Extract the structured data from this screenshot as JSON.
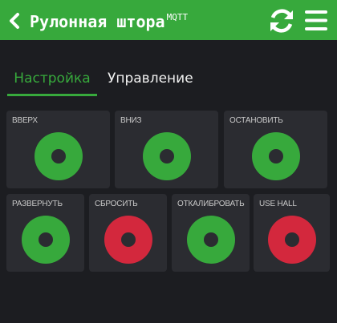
{
  "header": {
    "title": "Рулонная штора",
    "title_suffix": "MQTT",
    "background_color": "#37a93c",
    "back_icon": "chevron-left-icon",
    "refresh_icon": "refresh-icon",
    "menu_icon": "hamburger-menu-icon"
  },
  "tabs": [
    {
      "label": "Настройка",
      "active": true
    },
    {
      "label": "Управление",
      "active": false
    }
  ],
  "controls": [
    {
      "label": "ВВЕРХ",
      "state": "on",
      "color": "#37a93c"
    },
    {
      "label": "ВНИЗ",
      "state": "on",
      "color": "#37a93c"
    },
    {
      "label": "ОСТАНОВИТЬ",
      "state": "on",
      "color": "#37a93c"
    },
    {
      "label": "РАЗВЕРНУТЬ",
      "state": "on",
      "color": "#37a93c"
    },
    {
      "label": "СБРОСИТЬ",
      "state": "off",
      "color": "#d3283d"
    },
    {
      "label": "ОТКАЛИБРОВАТЬ",
      "state": "on",
      "color": "#37a93c"
    },
    {
      "label": "USE HALL",
      "state": "off",
      "color": "#d3283d"
    }
  ]
}
